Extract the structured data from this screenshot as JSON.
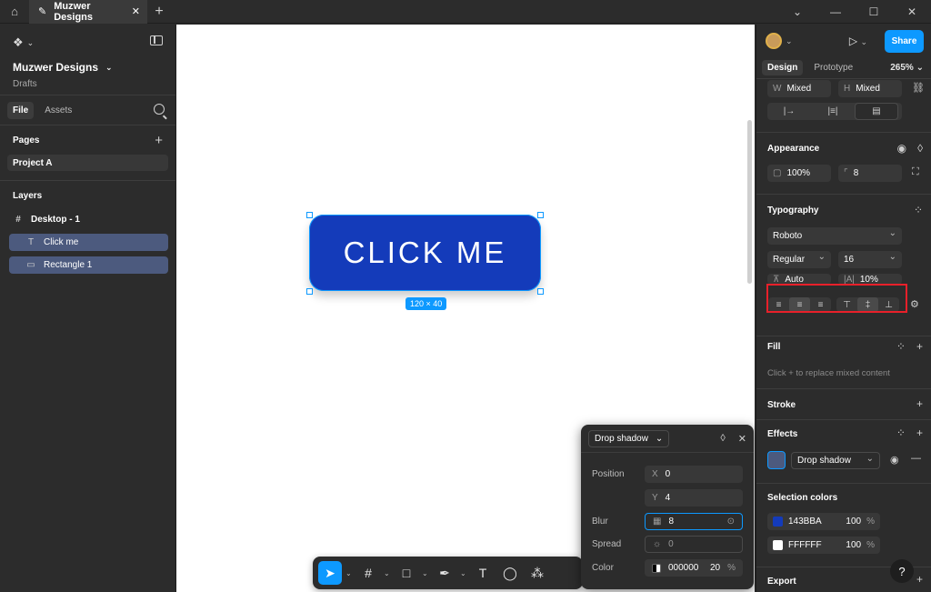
{
  "tabbar": {
    "tab_title": "Muzwer Designs",
    "home_icon": "home-icon",
    "tab_icon": "figma-file-icon"
  },
  "left": {
    "project_name": "Muzwer Designs",
    "project_sub": "Drafts",
    "tabs": [
      "File",
      "Assets"
    ],
    "pages_title": "Pages",
    "pages": [
      "Project A"
    ],
    "layers_title": "Layers",
    "layers": [
      {
        "name": "Desktop - 1",
        "icon": "frame-icon"
      },
      {
        "name": "Click me",
        "icon": "text-icon"
      },
      {
        "name": "Rectangle 1",
        "icon": "rectangle-icon"
      }
    ]
  },
  "canvas": {
    "button_text": "CLICK ME",
    "dimension_badge": "120 × 40",
    "button_color": "#143BBA"
  },
  "popup": {
    "effect": "Drop shadow",
    "position_label": "Position",
    "x_key": "X",
    "x": "0",
    "y_key": "Y",
    "y": "4",
    "blur_label": "Blur",
    "blur": "8",
    "spread_label": "Spread",
    "spread": "0",
    "color_label": "Color",
    "color_hex": "000000",
    "color_opacity": "20",
    "pct": "%"
  },
  "right": {
    "share": "Share",
    "tabs": [
      "Design",
      "Prototype"
    ],
    "zoom": "265%",
    "w_key": "W",
    "w": "Mixed",
    "h_key": "H",
    "h": "Mixed",
    "appearance": {
      "title": "Appearance",
      "opacity": "100%",
      "radius": "8"
    },
    "typography": {
      "title": "Typography",
      "font": "Roboto",
      "weight": "Regular",
      "size": "16",
      "line_height": "Auto",
      "letter_spacing": "10%"
    },
    "fill": {
      "title": "Fill",
      "hint": "Click + to replace mixed content"
    },
    "stroke": {
      "title": "Stroke"
    },
    "effects": {
      "title": "Effects",
      "effect": "Drop shadow"
    },
    "selection_colors": {
      "title": "Selection colors",
      "items": [
        {
          "hex": "143BBA",
          "opacity": "100",
          "pct": "%",
          "color": "#143BBA"
        },
        {
          "hex": "FFFFFF",
          "opacity": "100",
          "pct": "%",
          "color": "#FFFFFF"
        }
      ]
    },
    "export": {
      "title": "Export"
    },
    "help": "?"
  }
}
